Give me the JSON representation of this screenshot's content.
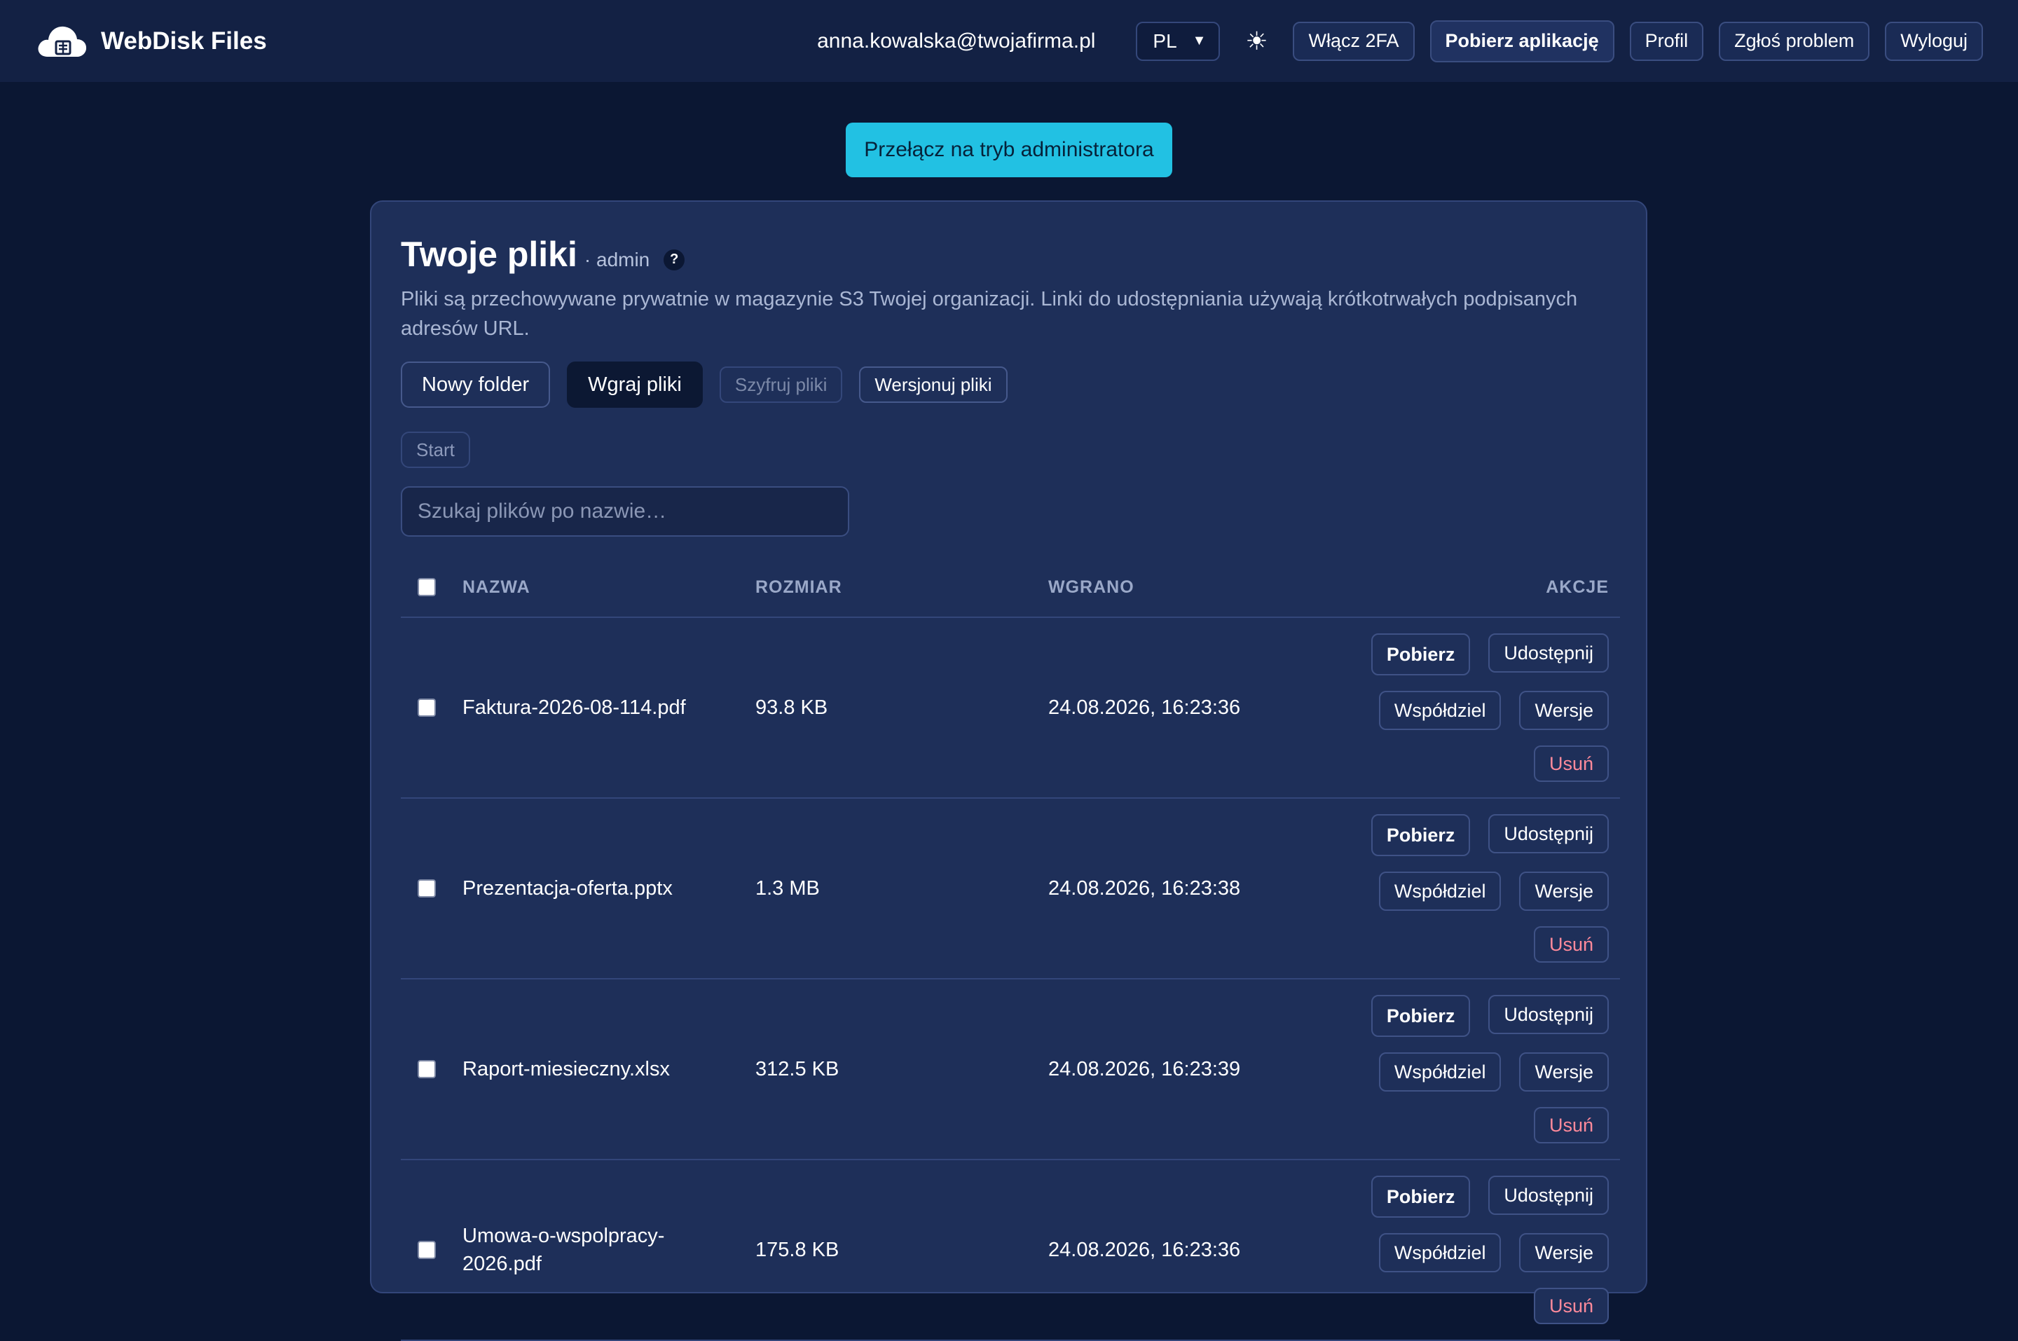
{
  "header": {
    "app_name": "WebDisk Files",
    "user_email": "anna.kowalska@twojafirma.pl",
    "language": "PL",
    "theme_icon": "sun-icon",
    "buttons": {
      "enable_2fa": "Włącz 2FA",
      "download_app": "Pobierz aplikację",
      "profile": "Profil",
      "report_problem": "Zgłoś problem",
      "logout": "Wyloguj"
    }
  },
  "admin_switch_label": "Przełącz na tryb administratora",
  "card": {
    "title": "Twoje pliki",
    "role": "· admin",
    "help": "?",
    "subtitle": "Pliki są przechowywane prywatnie w magazynie S3 Twojej organizacji. Linki do udostępniania używają krótkotrwałych podpisanych adresów URL.",
    "toolbar": {
      "new_folder": "Nowy folder",
      "upload": "Wgraj pliki",
      "encrypt": "Szyfruj pliki",
      "versioning": "Wersjonuj pliki"
    },
    "breadcrumb": "Start",
    "search_placeholder": "Szukaj plików po nazwie…"
  },
  "table": {
    "columns": [
      "NAZWA",
      "ROZMIAR",
      "WGRANO",
      "AKCJE"
    ],
    "actions": {
      "download": "Pobierz",
      "share": "Udostępnij",
      "collaborate": "Współdziel",
      "versions": "Wersje",
      "delete": "Usuń"
    },
    "rows": [
      {
        "name": "Faktura-2026-08-114.pdf",
        "size": "93.8 KB",
        "uploaded": "24.08.2026, 16:23:36"
      },
      {
        "name": "Prezentacja-oferta.pptx",
        "size": "1.3 MB",
        "uploaded": "24.08.2026, 16:23:38"
      },
      {
        "name": "Raport-miesieczny.xlsx",
        "size": "312.5 KB",
        "uploaded": "24.08.2026, 16:23:39"
      },
      {
        "name": "Umowa-o-wspolpracy-2026.pdf",
        "size": "175.8 KB",
        "uploaded": "24.08.2026, 16:23:36"
      }
    ]
  },
  "colors": {
    "background": "#0b1733",
    "topbar": "#132144",
    "card": "#1e2f59",
    "accent": "#22c1e3",
    "danger": "#ff8a9b"
  }
}
